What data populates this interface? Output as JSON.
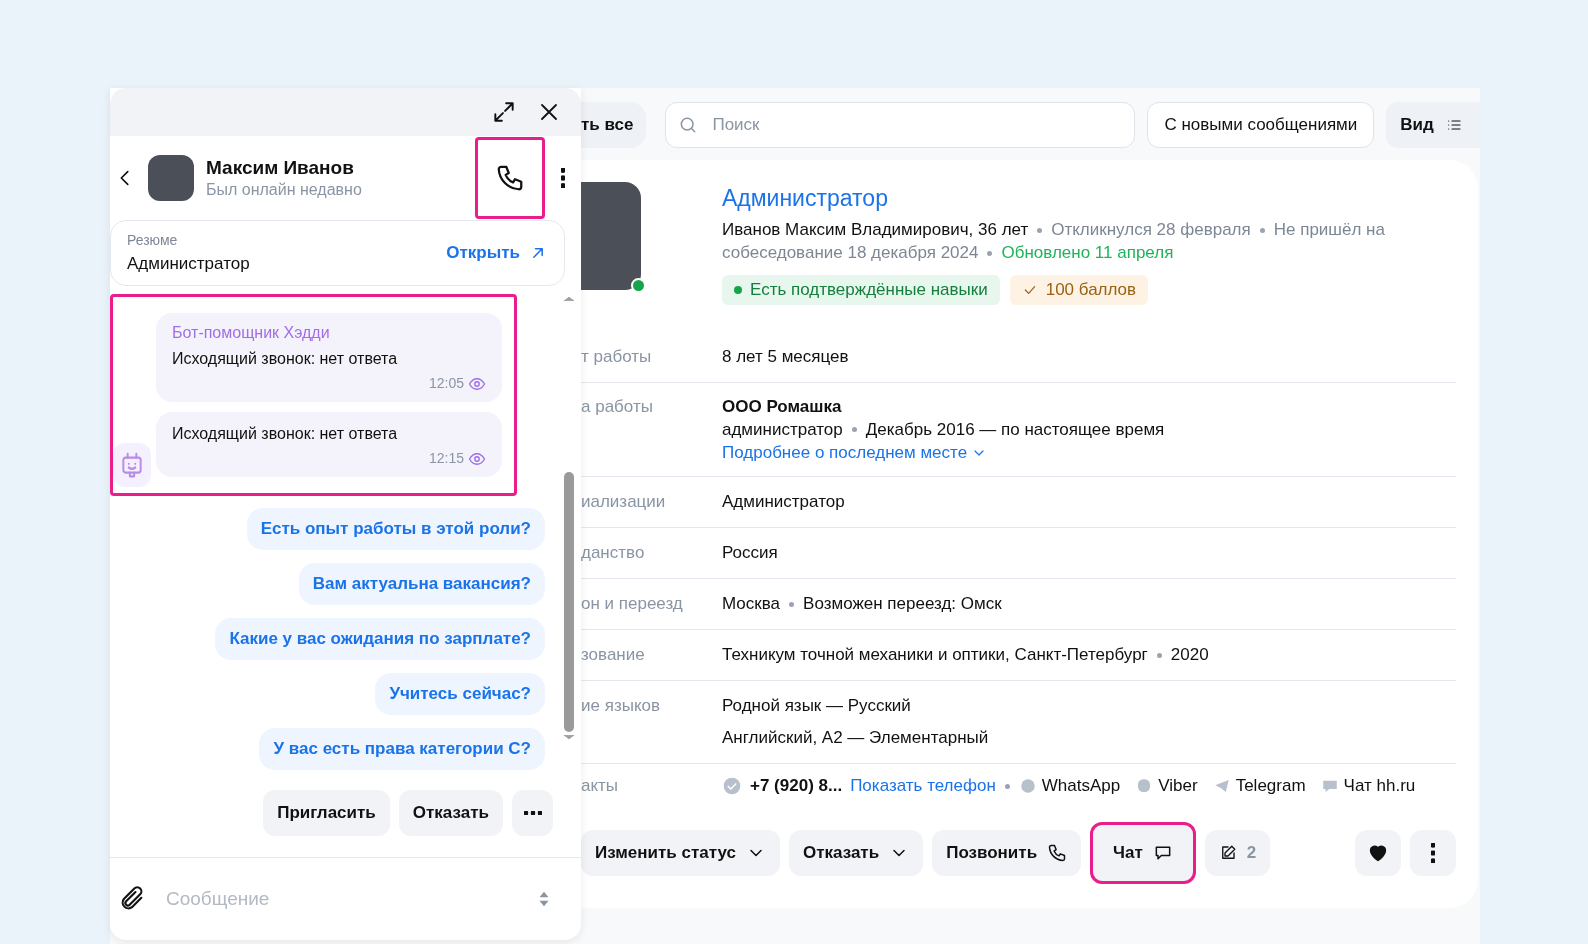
{
  "chat": {
    "contact": {
      "name": "Максим Иванов",
      "status": "Был онлайн недавно",
      "call_highlighted": true
    },
    "resume": {
      "label": "Резюме",
      "title": "Администратор",
      "link": "Открыть"
    },
    "messages_highlighted": true,
    "messages": [
      {
        "sender": "Бот-помощник Хэдди",
        "text": "Исходящий звонок: нет ответа",
        "time": "12:05",
        "seen": true
      },
      {
        "text": "Исходящий звонок: нет ответа",
        "time": "12:15",
        "seen": true
      }
    ],
    "quick_replies": [
      "Есть опыт работы в этой роли?",
      "Вам актуальна вакансия?",
      "Какие у вас ожидания по зарплате?",
      "Учитесь сейчас?",
      "У вас есть права категории С?"
    ],
    "actions": [
      "Пригласить",
      "Отказать"
    ],
    "composer": {
      "placeholder": "Сообщение"
    }
  },
  "toolbar": {
    "select_all": "ть все",
    "search": {
      "placeholder": "Поиск"
    },
    "filter": "С новыми сообщениями",
    "view": "Вид"
  },
  "candidate": {
    "title": "Администратор",
    "name_age": "Иванов Максим Владимирович, 36 лет",
    "meta": [
      "Откликнулся 28 февраля",
      "Не пришёл на собеседование 18 декабря 2024"
    ],
    "updated": "Обновлено 11 апреля",
    "online": true,
    "tags": [
      {
        "kind": "skills",
        "text": "Есть подтверждённые навыки"
      },
      {
        "kind": "score",
        "text": "100 баллов"
      }
    ]
  },
  "details": [
    {
      "kind": "text",
      "label": "т работы",
      "lines": [
        "8 лет 5 месяцев"
      ]
    },
    {
      "kind": "work",
      "label": "а работы",
      "company": "ООО Ромашка",
      "position": "администратор",
      "period": "Декабрь 2016 — по настоящее время",
      "link": "Подробнее о последнем месте"
    },
    {
      "kind": "text",
      "label": "иализации",
      "lines": [
        "Администратор"
      ]
    },
    {
      "kind": "text",
      "label": "данство",
      "lines": [
        "Россия"
      ]
    },
    {
      "kind": "dotted",
      "label": "он и переезд",
      "parts": [
        "Москва",
        "Возможен переезд: Омск"
      ]
    },
    {
      "kind": "dotted",
      "label": "зование",
      "parts": [
        "Техникум точной механики и оптики, Санкт-Петербург",
        "2020"
      ]
    },
    {
      "kind": "text",
      "label": "ие языков",
      "lines": [
        "Родной язык — Русский",
        "Английский, A2 — Элементарный"
      ]
    },
    {
      "kind": "contacts",
      "label": "акты",
      "phone": "+7 (920) 8...",
      "link": "Показать телефон",
      "messengers": [
        {
          "kind": "whatsapp",
          "text": "WhatsApp"
        },
        {
          "kind": "viber",
          "text": "Viber"
        },
        {
          "kind": "telegram",
          "text": "Telegram"
        },
        {
          "kind": "chat",
          "text": "Чат hh.ru"
        }
      ]
    }
  ],
  "actions": [
    {
      "kind": "dropdown",
      "label": "Изменить статус",
      "highlighted": false
    },
    {
      "kind": "dropdown",
      "label": "Отказать",
      "highlighted": false
    },
    {
      "kind": "call",
      "label": "Позвонить",
      "highlighted": false
    },
    {
      "kind": "chat",
      "label": "Чат",
      "highlighted": true
    },
    {
      "kind": "notes",
      "label": "2",
      "highlighted": false
    }
  ]
}
